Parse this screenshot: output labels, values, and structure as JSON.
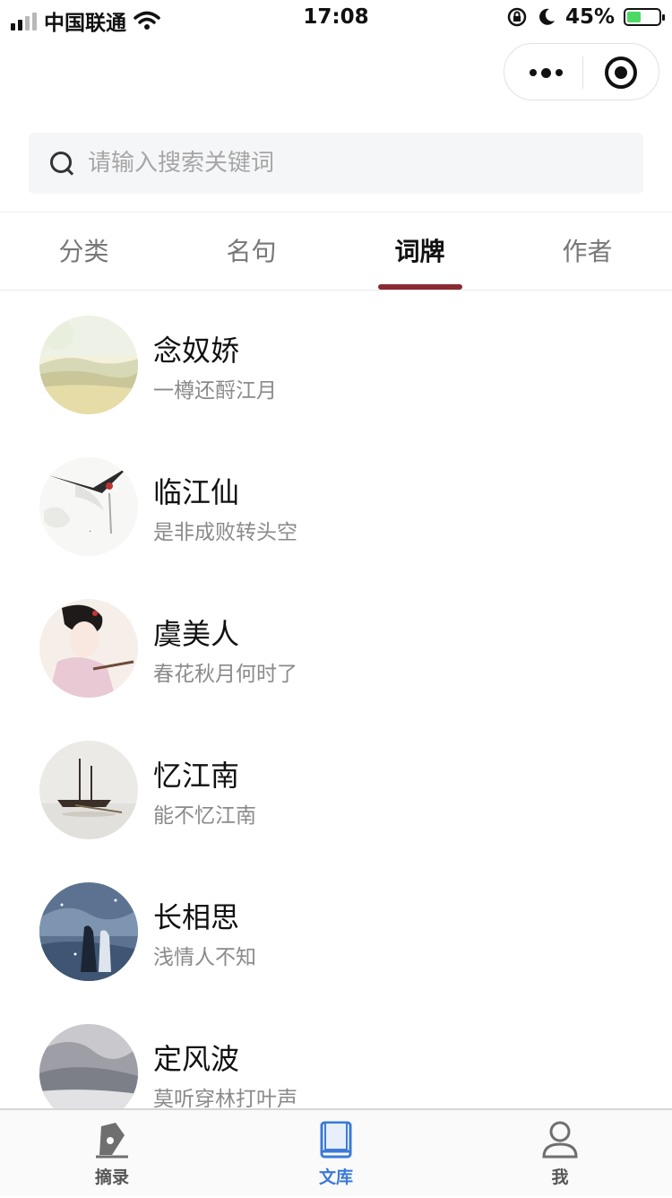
{
  "status_bar": {
    "carrier": "中国联通",
    "time": "17:08",
    "battery": "45%",
    "battery_level": 0.45
  },
  "search": {
    "placeholder": "请输入搜索关键词"
  },
  "tabs": [
    {
      "label": "分类",
      "active": false
    },
    {
      "label": "名句",
      "active": false
    },
    {
      "label": "词牌",
      "active": true
    },
    {
      "label": "作者",
      "active": false
    }
  ],
  "items": [
    {
      "title": "念奴娇",
      "subtitle": "一樽还酹江月"
    },
    {
      "title": "临江仙",
      "subtitle": "是非成败转头空"
    },
    {
      "title": "虞美人",
      "subtitle": "春花秋月何时了"
    },
    {
      "title": "忆江南",
      "subtitle": "能不忆江南"
    },
    {
      "title": "长相思",
      "subtitle": "浅情人不知"
    },
    {
      "title": "定风波",
      "subtitle": "莫听穿林打叶声"
    }
  ],
  "tabbar": [
    {
      "label": "摘录",
      "icon": "pen-nib-icon",
      "active": false
    },
    {
      "label": "文库",
      "icon": "book-icon",
      "active": true
    },
    {
      "label": "我",
      "icon": "user-icon",
      "active": false
    }
  ],
  "colors": {
    "accent": "#8a2a32",
    "tabbar_active": "#3b7ad8"
  }
}
